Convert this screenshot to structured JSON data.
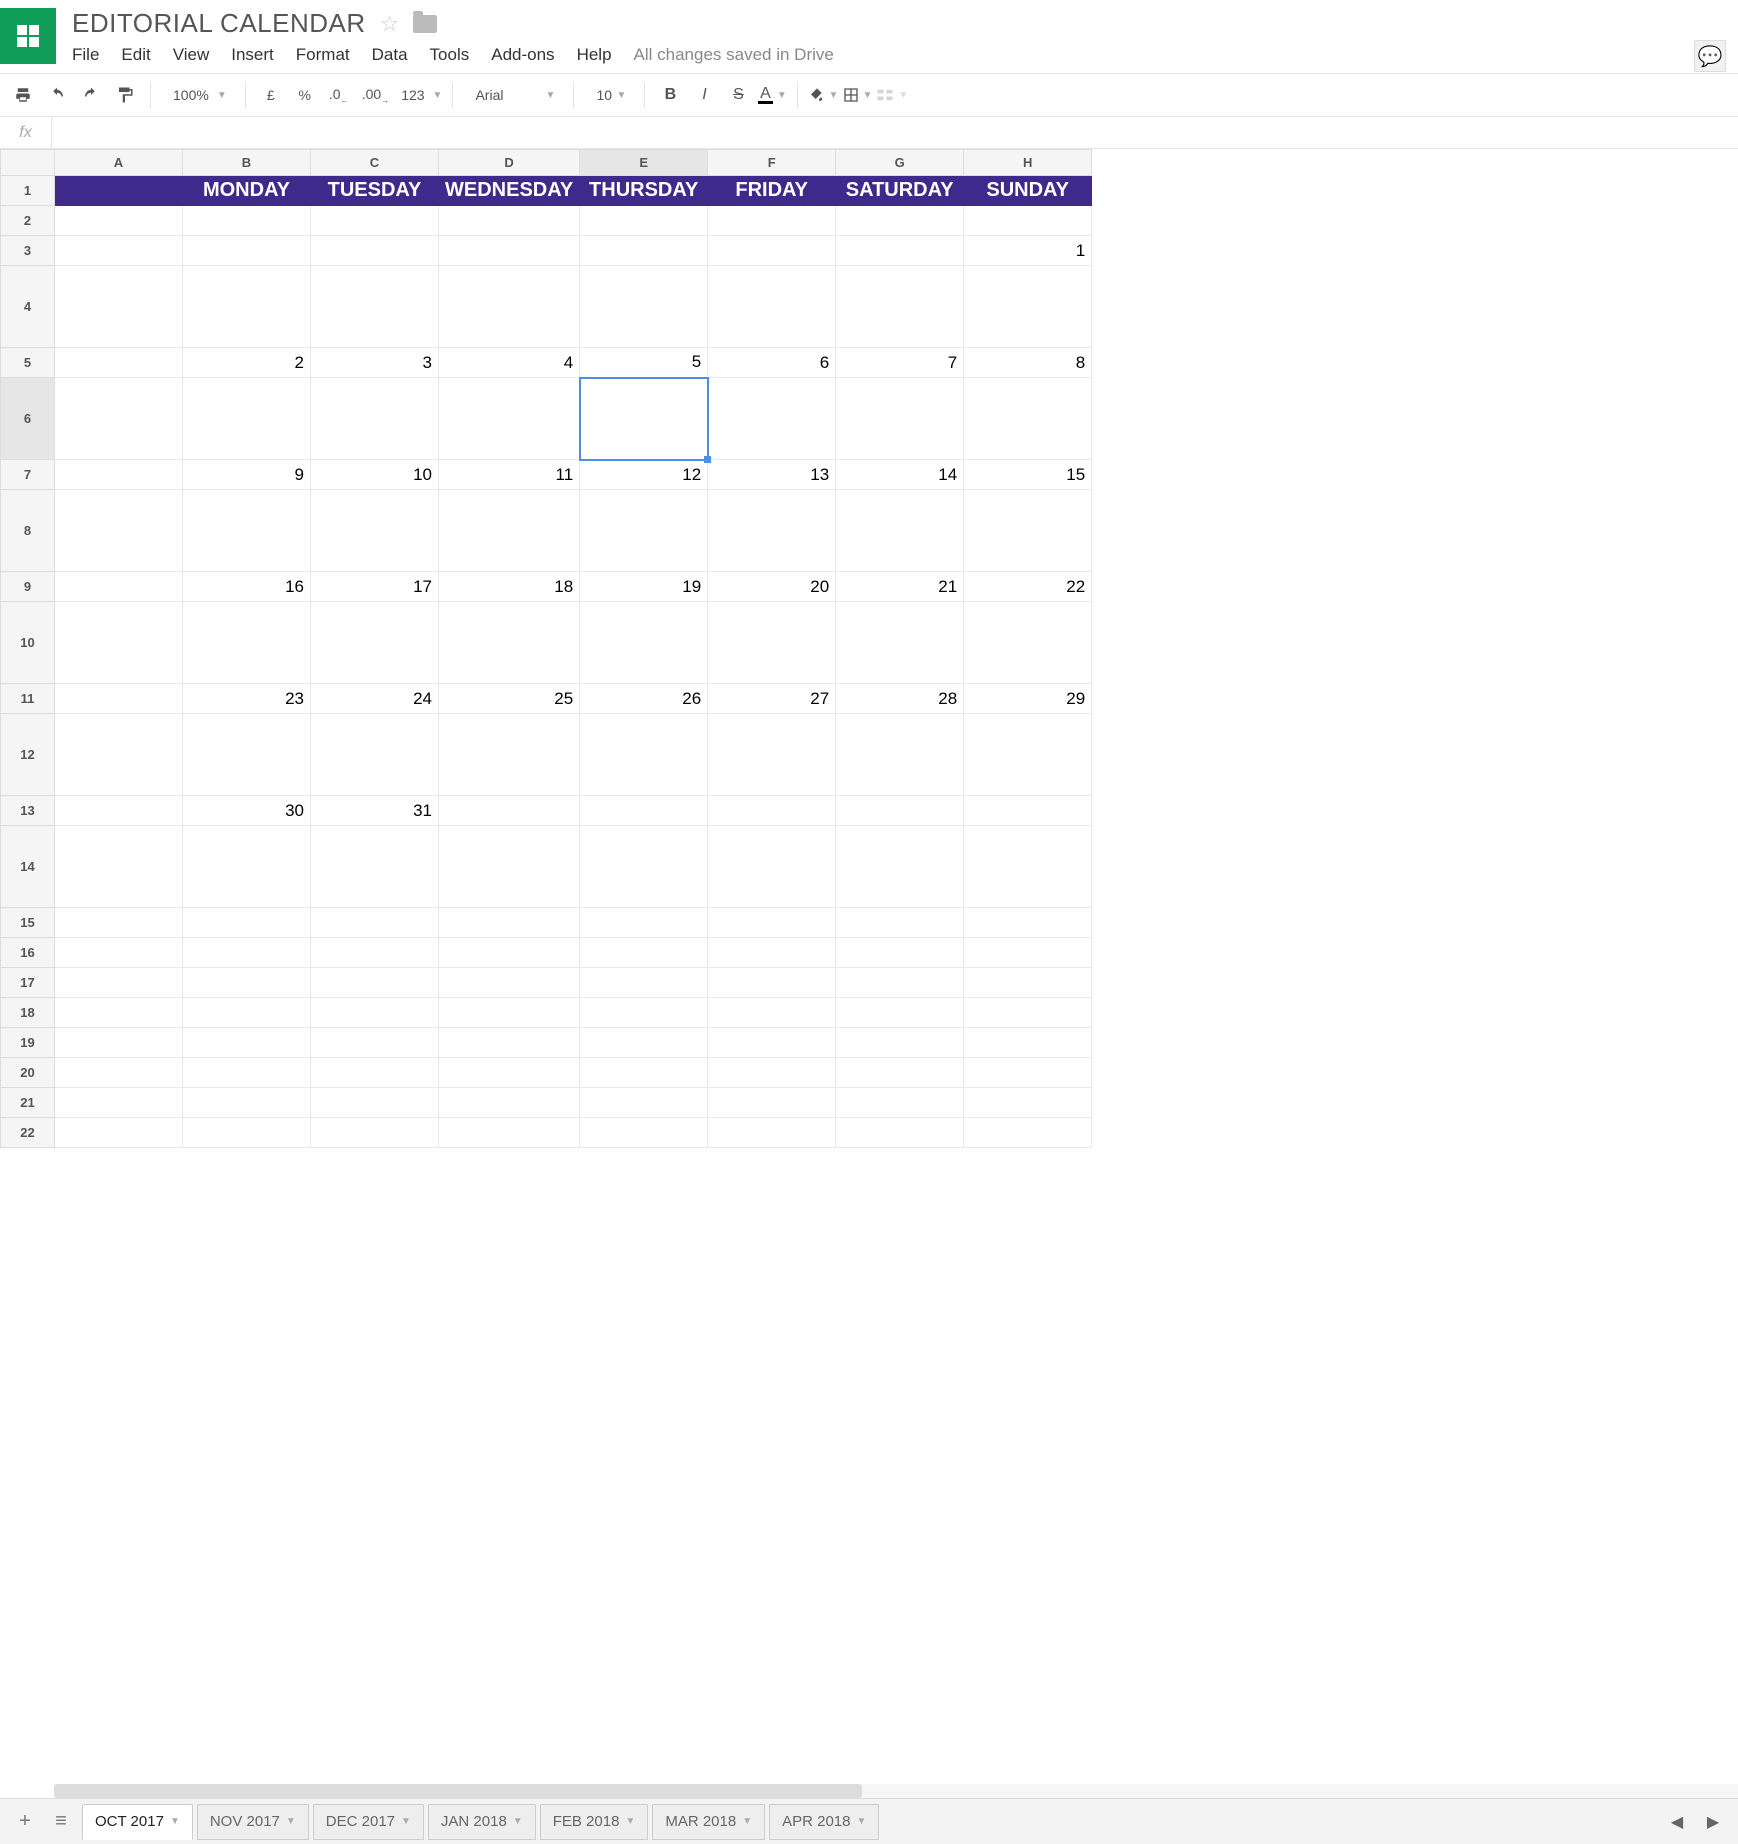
{
  "header": {
    "title": "EDITORIAL CALENDAR",
    "save_status": "All changes saved in Drive"
  },
  "menu": [
    "File",
    "Edit",
    "View",
    "Insert",
    "Format",
    "Data",
    "Tools",
    "Add-ons",
    "Help"
  ],
  "toolbar": {
    "zoom": "100%",
    "currency": "£",
    "percent": "%",
    "dec_less": ".0",
    "dec_more": ".00",
    "numfmt": "123",
    "font": "Arial",
    "size": "10"
  },
  "formula": {
    "label": "fx",
    "value": ""
  },
  "columns": [
    "A",
    "B",
    "C",
    "D",
    "E",
    "F",
    "G",
    "H"
  ],
  "active_col": "E",
  "active_row": 6,
  "selected_cell": "E6",
  "rows": [
    {
      "n": 1,
      "cls": "days-header",
      "h": "short",
      "cells": [
        "",
        "MONDAY",
        "TUESDAY",
        "WEDNESDAY",
        "THURSDAY",
        "FRIDAY",
        "SATURDAY",
        "SUNDAY"
      ]
    },
    {
      "n": 2,
      "h": "short",
      "cells": [
        "",
        "",
        "",
        "",
        "",
        "",
        "",
        ""
      ]
    },
    {
      "n": 3,
      "h": "short",
      "cells": [
        "",
        "",
        "",
        "",
        "",
        "",
        "",
        "1"
      ]
    },
    {
      "n": 4,
      "h": "tall",
      "cells": [
        "",
        "",
        "",
        "",
        "",
        "",
        "",
        ""
      ]
    },
    {
      "n": 5,
      "h": "short",
      "cells": [
        "",
        "2",
        "3",
        "4",
        "5",
        "6",
        "7",
        "8"
      ]
    },
    {
      "n": 6,
      "h": "tall",
      "cells": [
        "",
        "",
        "",
        "",
        "",
        "",
        "",
        ""
      ]
    },
    {
      "n": 7,
      "h": "short",
      "cells": [
        "",
        "9",
        "10",
        "11",
        "12",
        "13",
        "14",
        "15"
      ]
    },
    {
      "n": 8,
      "h": "tall",
      "cells": [
        "",
        "",
        "",
        "",
        "",
        "",
        "",
        ""
      ]
    },
    {
      "n": 9,
      "h": "short",
      "cells": [
        "",
        "16",
        "17",
        "18",
        "19",
        "20",
        "21",
        "22"
      ]
    },
    {
      "n": 10,
      "h": "tall",
      "cells": [
        "",
        "",
        "",
        "",
        "",
        "",
        "",
        ""
      ]
    },
    {
      "n": 11,
      "h": "short",
      "cells": [
        "",
        "23",
        "24",
        "25",
        "26",
        "27",
        "28",
        "29"
      ]
    },
    {
      "n": 12,
      "h": "tall",
      "cells": [
        "",
        "",
        "",
        "",
        "",
        "",
        "",
        ""
      ]
    },
    {
      "n": 13,
      "h": "short",
      "cells": [
        "",
        "30",
        "31",
        "",
        "",
        "",
        "",
        ""
      ]
    },
    {
      "n": 14,
      "h": "tall",
      "cells": [
        "",
        "",
        "",
        "",
        "",
        "",
        "",
        ""
      ]
    },
    {
      "n": 15,
      "h": "short",
      "cells": [
        "",
        "",
        "",
        "",
        "",
        "",
        "",
        ""
      ]
    },
    {
      "n": 16,
      "h": "short",
      "cells": [
        "",
        "",
        "",
        "",
        "",
        "",
        "",
        ""
      ]
    },
    {
      "n": 17,
      "h": "short",
      "cells": [
        "",
        "",
        "",
        "",
        "",
        "",
        "",
        ""
      ]
    },
    {
      "n": 18,
      "h": "short",
      "cells": [
        "",
        "",
        "",
        "",
        "",
        "",
        "",
        ""
      ]
    },
    {
      "n": 19,
      "h": "short",
      "cells": [
        "",
        "",
        "",
        "",
        "",
        "",
        "",
        ""
      ]
    },
    {
      "n": 20,
      "h": "short",
      "cells": [
        "",
        "",
        "",
        "",
        "",
        "",
        "",
        ""
      ]
    },
    {
      "n": 21,
      "h": "short",
      "cells": [
        "",
        "",
        "",
        "",
        "",
        "",
        "",
        ""
      ]
    },
    {
      "n": 22,
      "h": "short",
      "cells": [
        "",
        "",
        "",
        "",
        "",
        "",
        "",
        ""
      ]
    }
  ],
  "tabs": [
    "OCT 2017",
    "NOV 2017",
    "DEC 2017",
    "JAN 2018",
    "FEB 2018",
    "MAR 2018",
    "APR 2018"
  ],
  "active_tab": 0
}
